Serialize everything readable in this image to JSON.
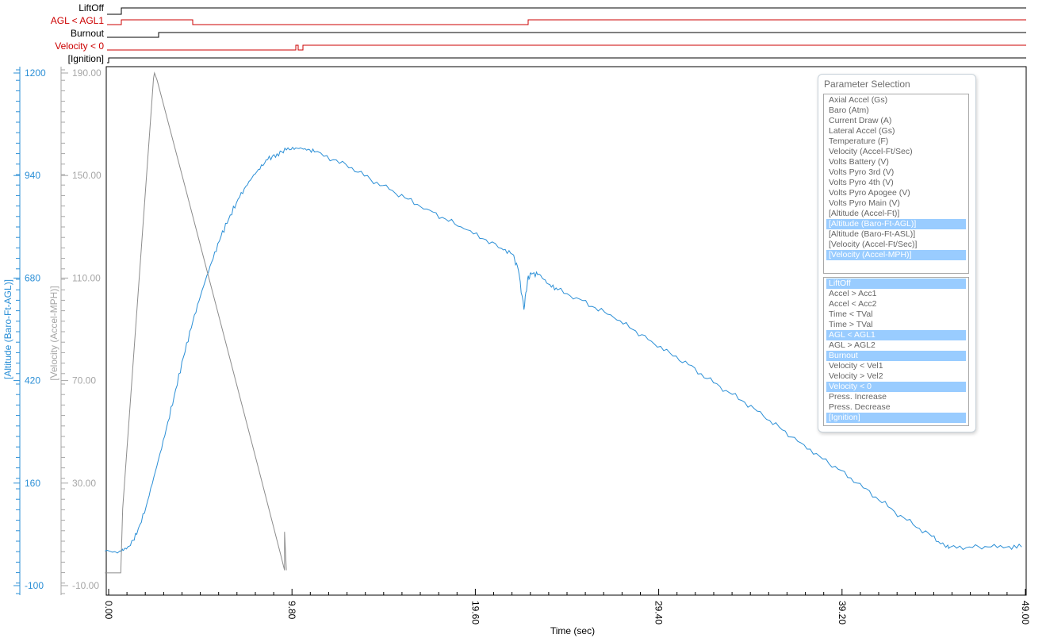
{
  "event_lines": [
    {
      "name": "LiftOff",
      "color": "#000000"
    },
    {
      "name": "AGL < AGL1",
      "color": "#cc0000"
    },
    {
      "name": "Burnout",
      "color": "#000000"
    },
    {
      "name": "Velocity < 0",
      "color": "#cc0000"
    },
    {
      "name": "[Ignition]",
      "color": "#000000"
    }
  ],
  "panel": {
    "title": "Parameter Selection",
    "parameters": [
      {
        "label": "Axial Accel (Gs)",
        "selected": false
      },
      {
        "label": "Baro (Atm)",
        "selected": false
      },
      {
        "label": "Current Draw (A)",
        "selected": false
      },
      {
        "label": "Lateral Accel (Gs)",
        "selected": false
      },
      {
        "label": "Temperature (F)",
        "selected": false
      },
      {
        "label": "Velocity (Accel-Ft/Sec)",
        "selected": false
      },
      {
        "label": "Volts Battery (V)",
        "selected": false
      },
      {
        "label": "Volts Pyro 3rd (V)",
        "selected": false
      },
      {
        "label": "Volts Pyro 4th (V)",
        "selected": false
      },
      {
        "label": "Volts Pyro Apogee (V)",
        "selected": false
      },
      {
        "label": "Volts Pyro Main (V)",
        "selected": false
      },
      {
        "label": "[Altitude (Accel-Ft)]",
        "selected": false
      },
      {
        "label": "[Altitude (Baro-Ft-AGL)]",
        "selected": true
      },
      {
        "label": "[Altitude (Baro-Ft-ASL)]",
        "selected": false
      },
      {
        "label": "[Velocity (Accel-Ft/Sec)]",
        "selected": false
      },
      {
        "label": "[Velocity (Accel-MPH)]",
        "selected": true
      }
    ],
    "events": [
      {
        "label": "LiftOff",
        "selected": true
      },
      {
        "label": "Accel > Acc1",
        "selected": false
      },
      {
        "label": "Accel < Acc2",
        "selected": false
      },
      {
        "label": "Time < TVal",
        "selected": false
      },
      {
        "label": "Time > TVal",
        "selected": false
      },
      {
        "label": "AGL < AGL1",
        "selected": true
      },
      {
        "label": "AGL > AGL2",
        "selected": false
      },
      {
        "label": "Burnout",
        "selected": true
      },
      {
        "label": "Velocity < Vel1",
        "selected": false
      },
      {
        "label": "Velocity > Vel2",
        "selected": false
      },
      {
        "label": "Velocity < 0",
        "selected": true
      },
      {
        "label": "Press. Increase",
        "selected": false
      },
      {
        "label": "Press. Decrease",
        "selected": false
      },
      {
        "label": "[Ignition]",
        "selected": true
      }
    ]
  },
  "chart_data": {
    "type": "line",
    "xlabel": "Time (sec)",
    "xlim": [
      0,
      49.0
    ],
    "x_ticks": [
      "0.00",
      "9.80",
      "19.60",
      "29.40",
      "39.20",
      "49.00"
    ],
    "axes": [
      {
        "label": "[Altitude (Baro-Ft-AGL)]",
        "color": "#2b8fd6",
        "ylim": [
          -100,
          1200
        ],
        "ticks": [
          "1200",
          "940",
          "680",
          "420",
          "160",
          "-100"
        ]
      },
      {
        "label": "[Velocity (Accel-MPH)]",
        "color": "#a6a6a6",
        "ylim": [
          -10.0,
          190.0
        ],
        "ticks": [
          "190.00",
          "150.00",
          "110.00",
          "70.00",
          "30.00",
          "-10.00"
        ]
      }
    ],
    "series": [
      {
        "name": "[Altitude (Baro-Ft-AGL)]",
        "color": "#2b8fd6",
        "axis": 0,
        "points": [
          [
            -0.2,
            -12
          ],
          [
            0.6,
            -12
          ],
          [
            0.8,
            -10
          ],
          [
            1.1,
            0
          ],
          [
            1.5,
            30
          ],
          [
            2.0,
            100
          ],
          [
            2.5,
            190
          ],
          [
            3.0,
            280
          ],
          [
            3.5,
            380
          ],
          [
            4.0,
            480
          ],
          [
            4.5,
            570
          ],
          [
            5.0,
            650
          ],
          [
            5.5,
            720
          ],
          [
            6.0,
            785
          ],
          [
            6.5,
            840
          ],
          [
            7.0,
            885
          ],
          [
            7.5,
            925
          ],
          [
            8.0,
            955
          ],
          [
            8.5,
            980
          ],
          [
            9.0,
            995
          ],
          [
            9.5,
            1005
          ],
          [
            10.0,
            1010
          ],
          [
            10.5,
            1008
          ],
          [
            11.0,
            1000
          ],
          [
            12.0,
            980
          ],
          [
            13.0,
            960
          ],
          [
            14.0,
            930
          ],
          [
            15.0,
            905
          ],
          [
            16.0,
            880
          ],
          [
            17.0,
            855
          ],
          [
            18.0,
            830
          ],
          [
            19.0,
            805
          ],
          [
            20.0,
            780
          ],
          [
            21.0,
            755
          ],
          [
            21.6,
            740
          ],
          [
            21.9,
            700
          ],
          [
            22.2,
            600
          ],
          [
            22.4,
            680
          ],
          [
            22.6,
            690
          ],
          [
            23.0,
            690
          ],
          [
            23.5,
            665
          ],
          [
            24.0,
            650
          ],
          [
            25.0,
            630
          ],
          [
            26.0,
            605
          ],
          [
            27.0,
            580
          ],
          [
            28.0,
            550
          ],
          [
            29.0,
            520
          ],
          [
            30.0,
            490
          ],
          [
            31.0,
            460
          ],
          [
            32.0,
            425
          ],
          [
            33.0,
            395
          ],
          [
            34.0,
            365
          ],
          [
            35.0,
            330
          ],
          [
            36.0,
            295
          ],
          [
            37.0,
            262
          ],
          [
            38.0,
            228
          ],
          [
            39.0,
            195
          ],
          [
            40.0,
            160
          ],
          [
            41.0,
            125
          ],
          [
            42.0,
            88
          ],
          [
            43.0,
            55
          ],
          [
            44.0,
            25
          ],
          [
            44.7,
            0
          ],
          [
            45.0,
            -2
          ],
          [
            46.0,
            -2
          ],
          [
            47.0,
            -2
          ],
          [
            48.0,
            -2
          ],
          [
            48.8,
            -2
          ]
        ]
      },
      {
        "name": "[Velocity (Accel-MPH)]",
        "color": "#8c8c8c",
        "axis": 1,
        "points": [
          [
            -0.2,
            -5
          ],
          [
            0.65,
            -5
          ],
          [
            0.75,
            20
          ],
          [
            2.4,
            188
          ],
          [
            2.45,
            190
          ],
          [
            2.6,
            187
          ],
          [
            4.0,
            148
          ],
          [
            6.0,
            92
          ],
          [
            8.0,
            36
          ],
          [
            9.2,
            2
          ],
          [
            9.4,
            -4
          ],
          [
            9.4,
            11
          ],
          [
            9.5,
            -4
          ]
        ]
      }
    ]
  }
}
